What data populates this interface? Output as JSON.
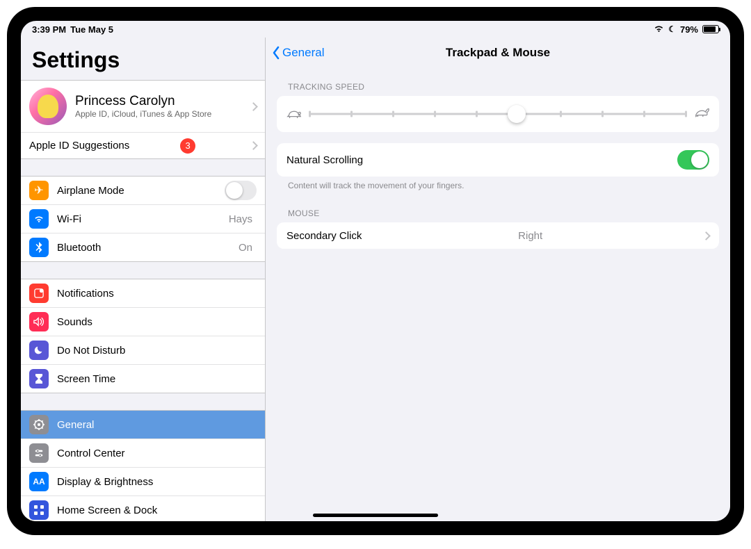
{
  "status": {
    "time": "3:39 PM",
    "date": "Tue May 5",
    "battery_pct": "79%",
    "dnd_icon": "☾"
  },
  "sidebar": {
    "title": "Settings",
    "profile": {
      "name": "Princess Carolyn",
      "subtitle": "Apple ID, iCloud, iTunes & App Store"
    },
    "apple_id_suggestions": {
      "label": "Apple ID Suggestions",
      "badge": "3"
    },
    "items": {
      "airplane": "Airplane Mode",
      "wifi": "Wi-Fi",
      "wifi_value": "Hays",
      "bluetooth": "Bluetooth",
      "bluetooth_value": "On",
      "notifications": "Notifications",
      "sounds": "Sounds",
      "dnd": "Do Not Disturb",
      "screentime": "Screen Time",
      "general": "General",
      "control_center": "Control Center",
      "display": "Display & Brightness",
      "home": "Home Screen & Dock"
    }
  },
  "detail": {
    "back_label": "General",
    "title": "Trackpad & Mouse",
    "tracking_header": "TRACKING SPEED",
    "tracking_value_pct": 55,
    "natural_scrolling": {
      "label": "Natural Scrolling",
      "on": true,
      "footnote": "Content will track the movement of your fingers."
    },
    "mouse_header": "MOUSE",
    "secondary_click": {
      "label": "Secondary Click",
      "value": "Right"
    }
  }
}
